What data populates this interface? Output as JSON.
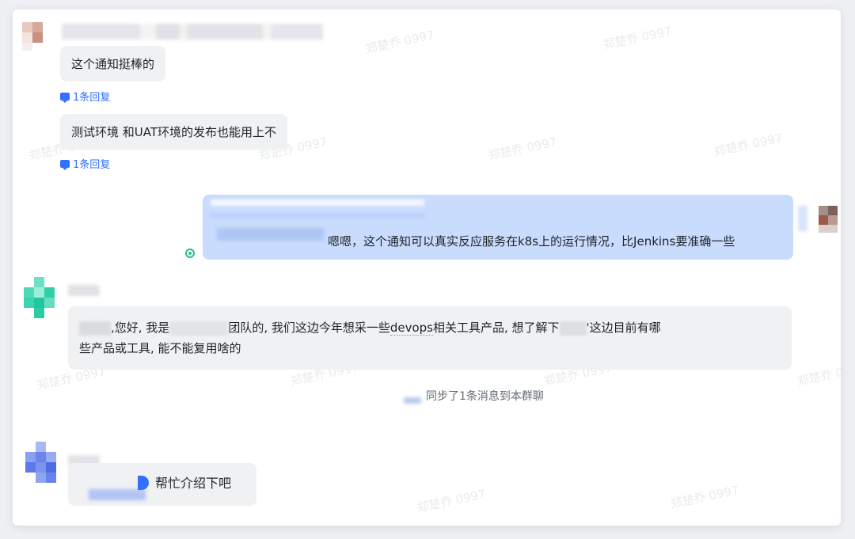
{
  "watermark": "郑楚乔 0997",
  "messages": [
    {
      "id": "m1",
      "text": "这个通知挺棒的",
      "reply_count": "1条回复"
    },
    {
      "id": "m2",
      "text": "测试环境 和UAT环境的发布也能用上不",
      "reply_count": "1条回复"
    },
    {
      "id": "m3",
      "text": "嗯嗯，这个通知可以真实反应服务在k8s上的运行情况，比Jenkins要准确一些"
    },
    {
      "id": "m4",
      "part1": ",您好, 我是",
      "part2": "团队的, 我们这边今年想采一些",
      "link": "devops",
      "part3": "相关工具产品, 想了解下",
      "part4": "'这边目前有哪",
      "line2": "些产品或工具, 能不能复用啥的"
    },
    {
      "id": "m5",
      "text": "帮忙介绍下吧"
    }
  ],
  "system_message": "同步了1条消息到本群聊",
  "colors": {
    "accent": "#3370ff",
    "sent_bubble": "#c9dcfd",
    "received_bubble": "#f0f1f3",
    "read_check": "#2dbf8f"
  }
}
